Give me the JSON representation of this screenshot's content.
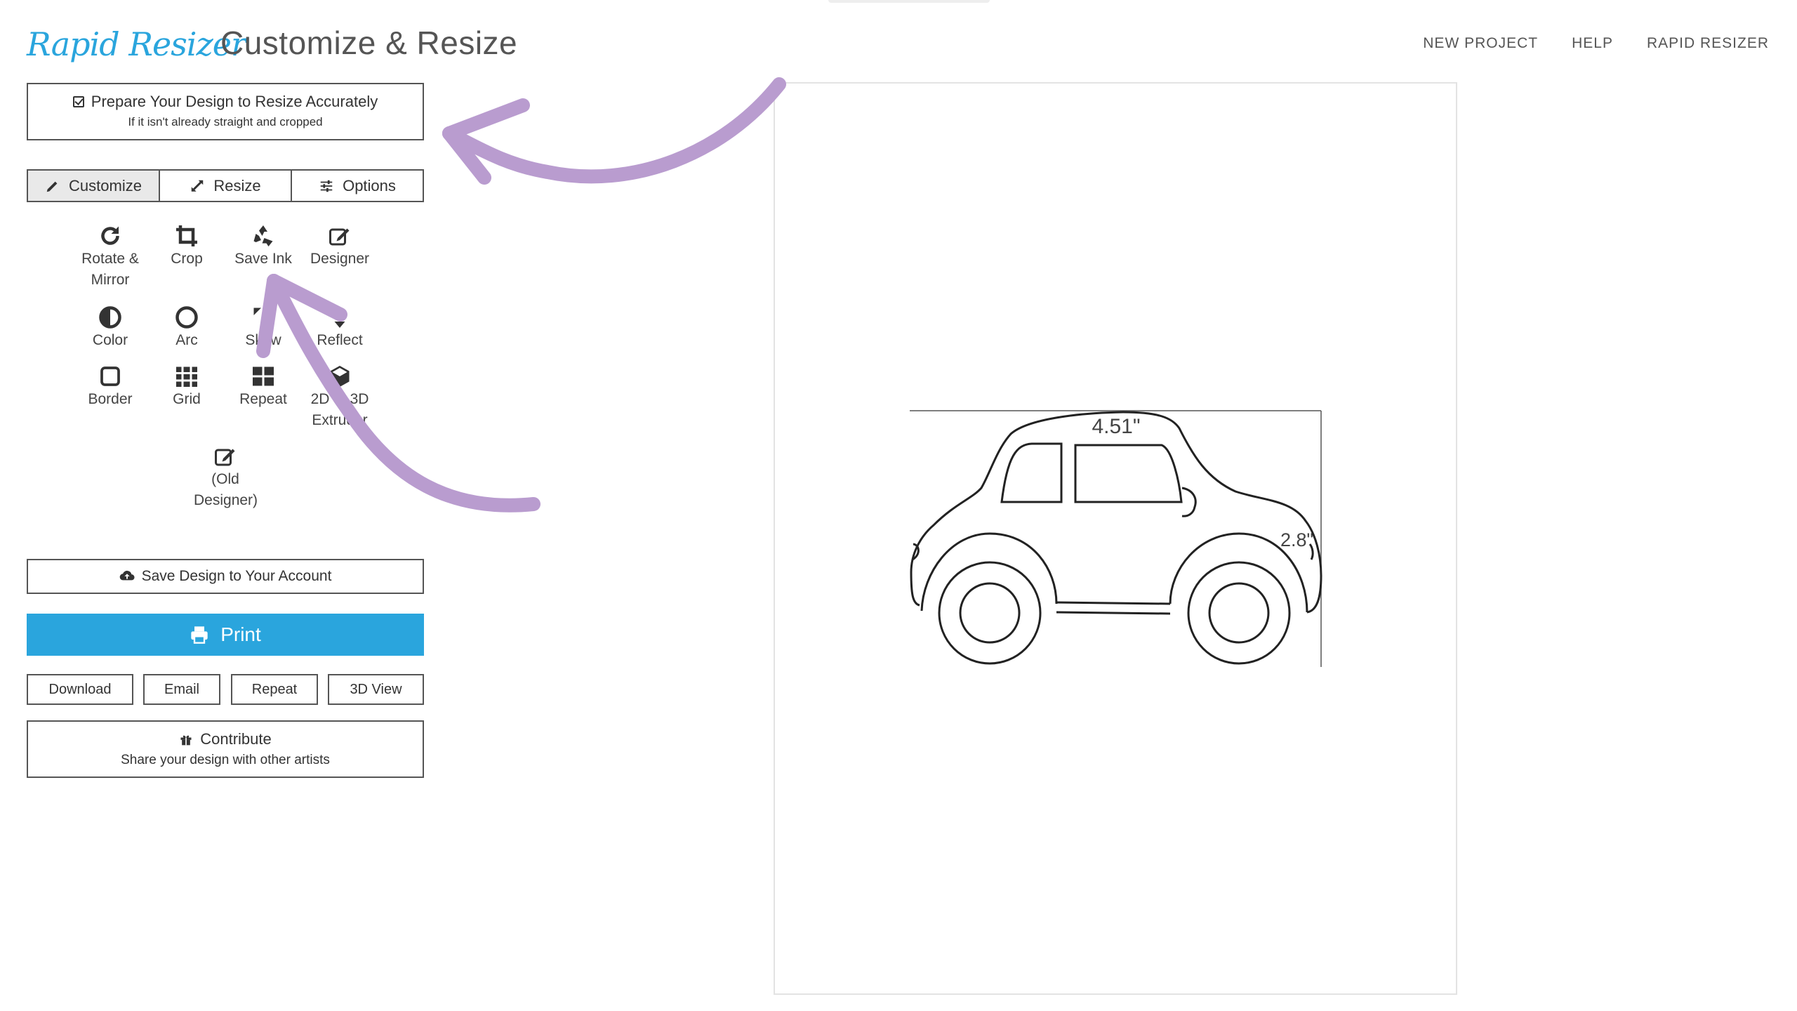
{
  "header": {
    "logo_text": "Rapid Resizer",
    "page_title": "Customize & Resize",
    "nav": [
      "NEW PROJECT",
      "HELP",
      "RAPID RESIZER"
    ]
  },
  "prepare": {
    "title": "Prepare Your Design to Resize Accurately",
    "subtitle": "If it isn't already straight and cropped"
  },
  "tabs": [
    {
      "label": "Customize",
      "icon": "pencil-icon",
      "active": true
    },
    {
      "label": "Resize",
      "icon": "expand-icon",
      "active": false
    },
    {
      "label": "Options",
      "icon": "sliders-icon",
      "active": false
    }
  ],
  "tools": [
    {
      "label": "Rotate & Mirror",
      "icon": "rotate-icon"
    },
    {
      "label": "Crop",
      "icon": "crop-icon"
    },
    {
      "label": "Save Ink",
      "icon": "recycle-icon"
    },
    {
      "label": "Designer",
      "icon": "edit-icon"
    },
    {
      "label": "Color",
      "icon": "contrast-icon"
    },
    {
      "label": "Arc",
      "icon": "circle-icon"
    },
    {
      "label": "Skew",
      "icon": "skew-icon"
    },
    {
      "label": "Reflect",
      "icon": "reflect-icon"
    },
    {
      "label": "Border",
      "icon": "square-icon"
    },
    {
      "label": "Grid",
      "icon": "grid-icon"
    },
    {
      "label": "Repeat",
      "icon": "tiles-icon"
    },
    {
      "label": "2D to 3D Extruder",
      "icon": "cube-icon"
    },
    {
      "label": "(Old Designer)",
      "icon": "edit-icon"
    }
  ],
  "actions": {
    "save_account": "Save Design to Your Account",
    "print": "Print",
    "small": [
      "Download",
      "Email",
      "Repeat",
      "3D View"
    ],
    "contribute_title": "Contribute",
    "contribute_subtitle": "Share your design with other artists"
  },
  "design": {
    "width_label": "4.51\"",
    "height_label": "2.8\""
  },
  "colors": {
    "accent": "#2aa5dd",
    "annotation_arrow": "#b99ccf"
  }
}
